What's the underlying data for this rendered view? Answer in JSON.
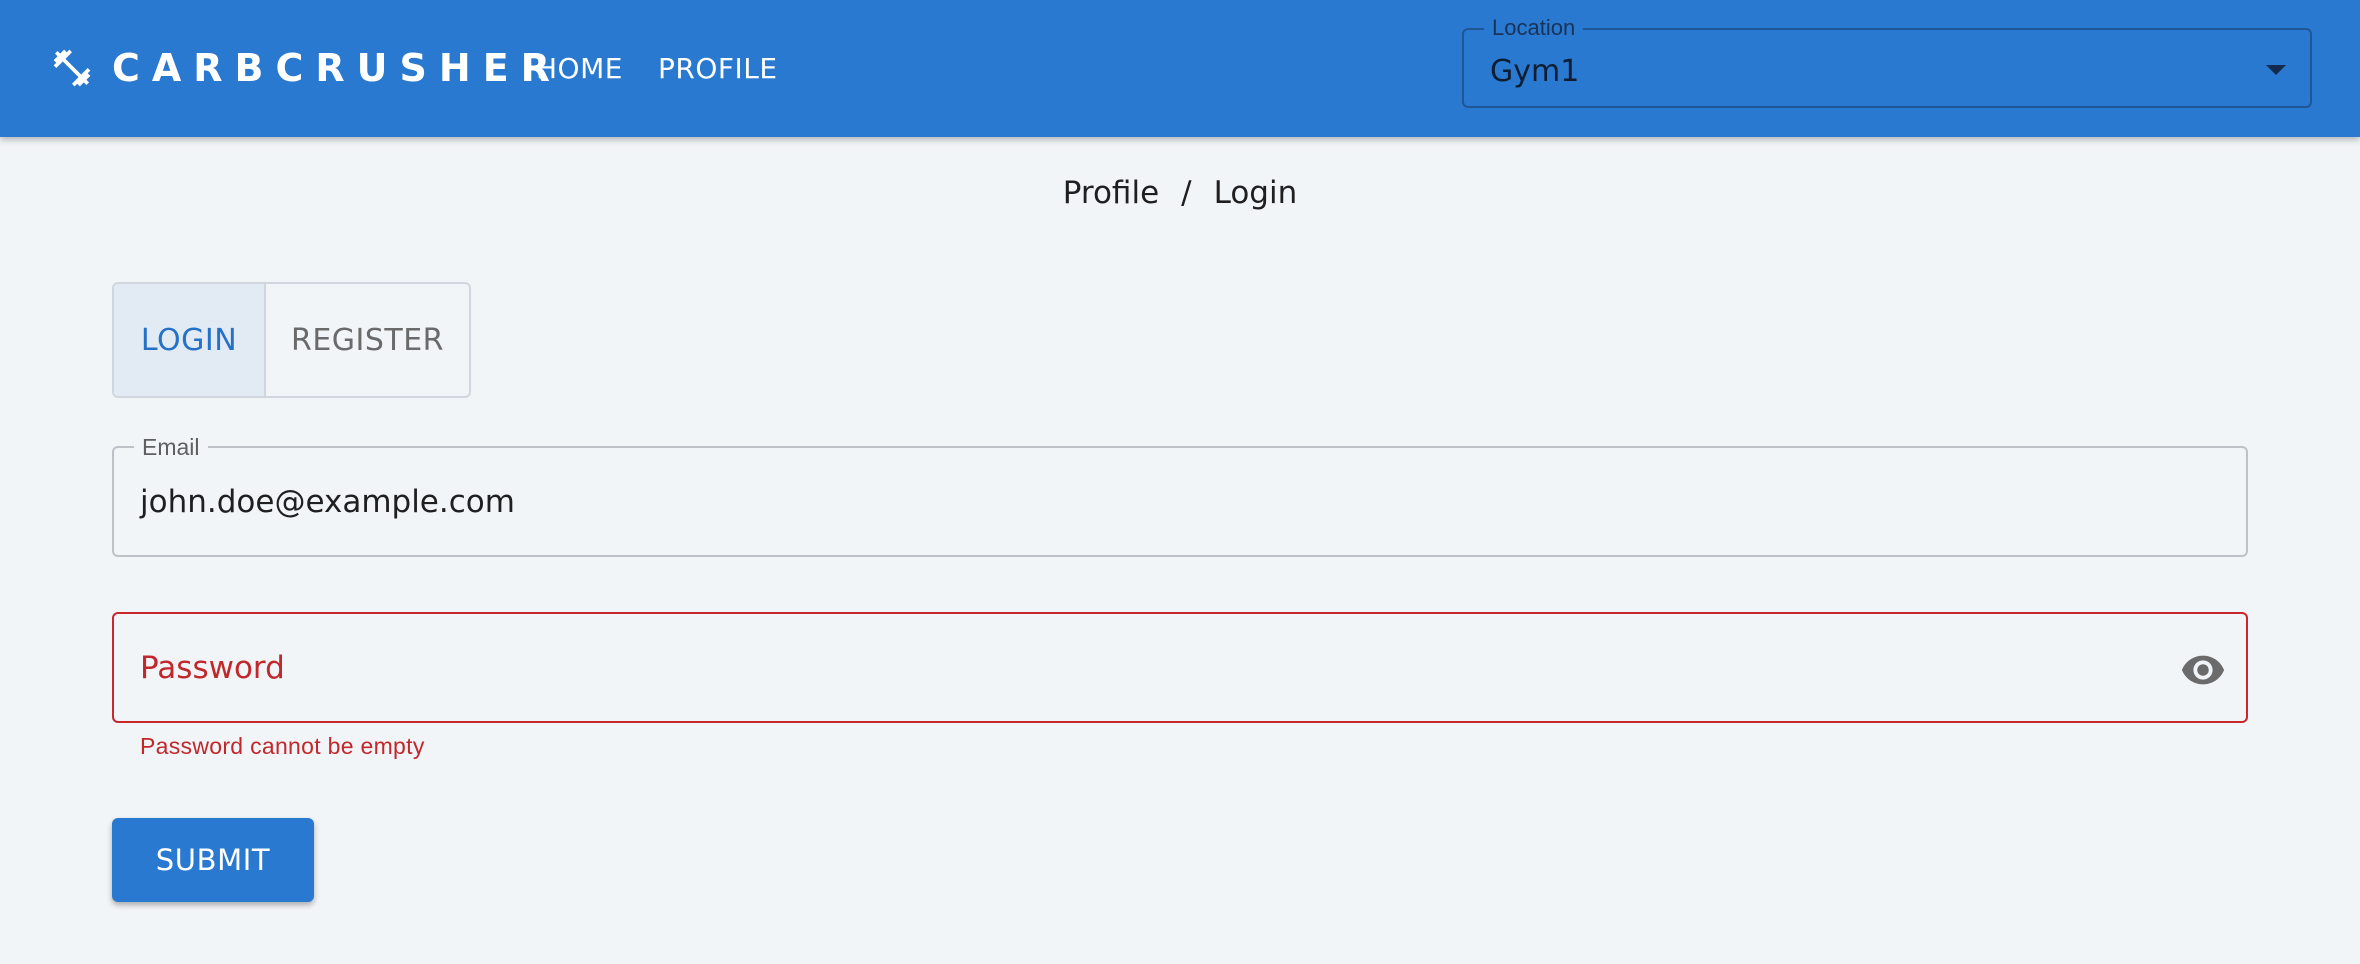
{
  "app": {
    "brand": "CARBCRUSHER",
    "brand_icon": "dumbbell-icon",
    "nav": {
      "home_label": "HOME",
      "profile_label": "PROFILE"
    },
    "location": {
      "label": "Location",
      "value": "Gym1"
    }
  },
  "breadcrumb": {
    "items": [
      "Profile",
      "Login"
    ],
    "separator": "/"
  },
  "auth_tabs": {
    "login_label": "LOGIN",
    "register_label": "REGISTER",
    "selected": "LOGIN"
  },
  "form": {
    "email": {
      "label": "Email",
      "value": "john.doe@example.com"
    },
    "password": {
      "placeholder": "Password",
      "error": "Password cannot be empty",
      "toggle_icon": "eye-icon"
    },
    "submit_label": "SUBMIT"
  },
  "colors": {
    "primary": "#2979d0",
    "background": "#f2f5f8",
    "error": "#c9272b",
    "tab_selected_bg": "#e2ebf4"
  }
}
